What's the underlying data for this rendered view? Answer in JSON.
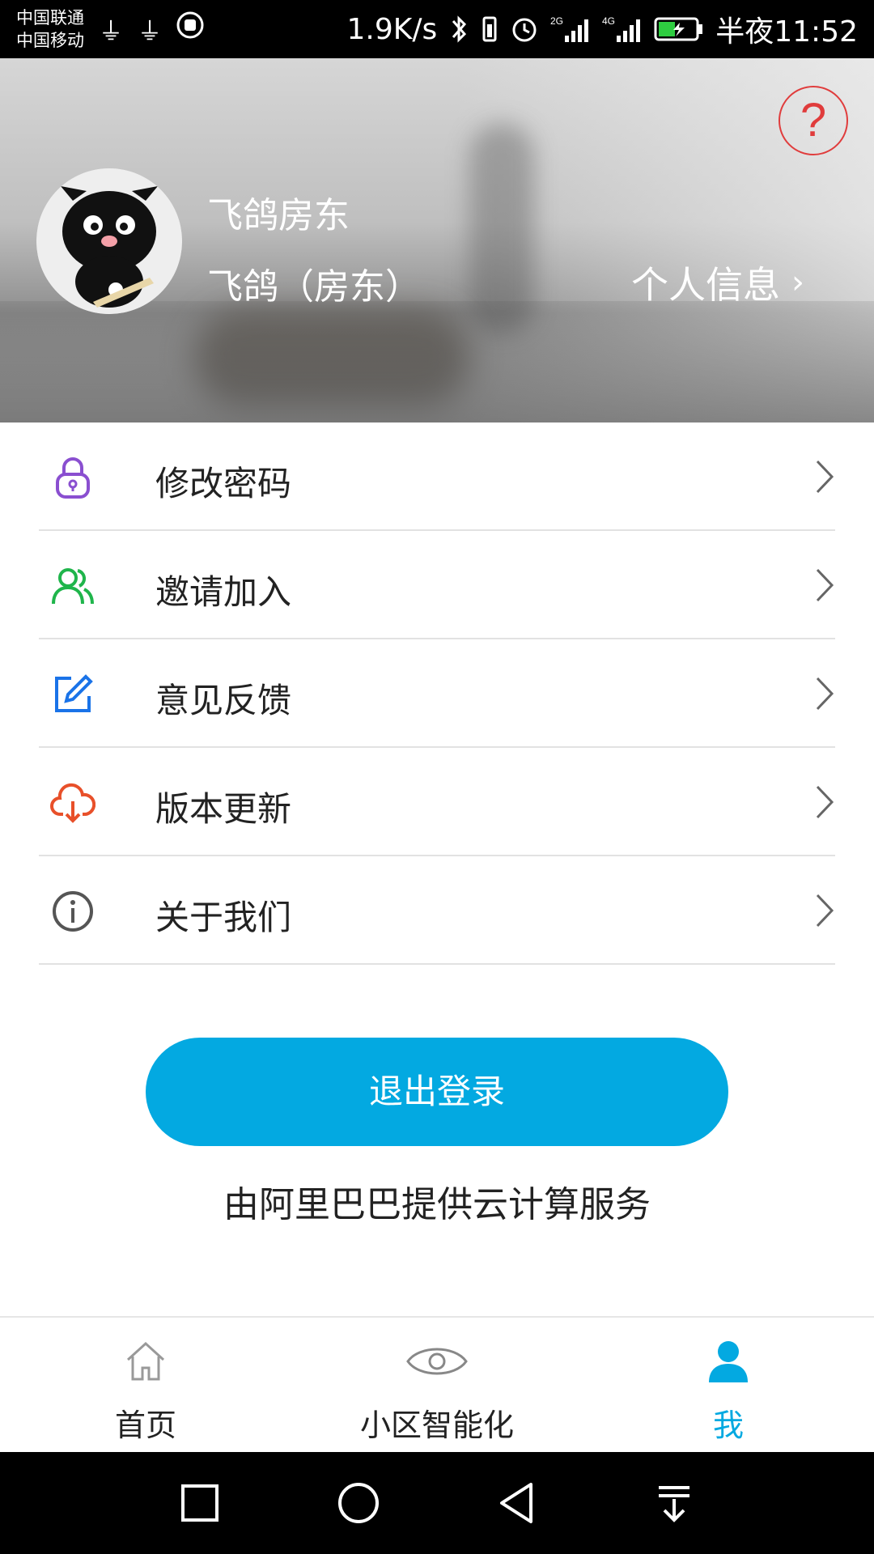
{
  "status_bar": {
    "carrier_1": "中国联通",
    "carrier_2": "中国移动",
    "speed": "1.9K/s",
    "net_2g": "2G",
    "net_4g": "4G",
    "time": "半夜11:52"
  },
  "header": {
    "help_symbol": "?",
    "username": "飞鸽房东",
    "role_line": "飞鸽（房东）",
    "profile_link": "个人信息",
    "profile_chevron": "›"
  },
  "menu": {
    "items": [
      {
        "label": "修改密码",
        "icon": "lock-icon",
        "color": "#8a4fd0"
      },
      {
        "label": "邀请加入",
        "icon": "users-icon",
        "color": "#1fb54b"
      },
      {
        "label": "意见反馈",
        "icon": "edit-icon",
        "color": "#1a73e8"
      },
      {
        "label": "版本更新",
        "icon": "cloud-download-icon",
        "color": "#e8502a"
      },
      {
        "label": "关于我们",
        "icon": "info-icon",
        "color": "#555555"
      }
    ]
  },
  "logout": {
    "label": "退出登录",
    "color": "#03a9e1"
  },
  "footer_note": "由阿里巴巴提供云计算服务",
  "bottom_nav": {
    "items": [
      {
        "label": "首页",
        "icon": "home-icon",
        "active": false
      },
      {
        "label": "小区智能化",
        "icon": "eye-icon",
        "active": false
      },
      {
        "label": "我",
        "icon": "person-icon",
        "active": true
      }
    ],
    "active_color": "#03a9e1"
  },
  "system_nav": {
    "buttons": [
      "recent-apps-icon",
      "home-circle-icon",
      "back-icon",
      "notification-pull-icon"
    ]
  }
}
